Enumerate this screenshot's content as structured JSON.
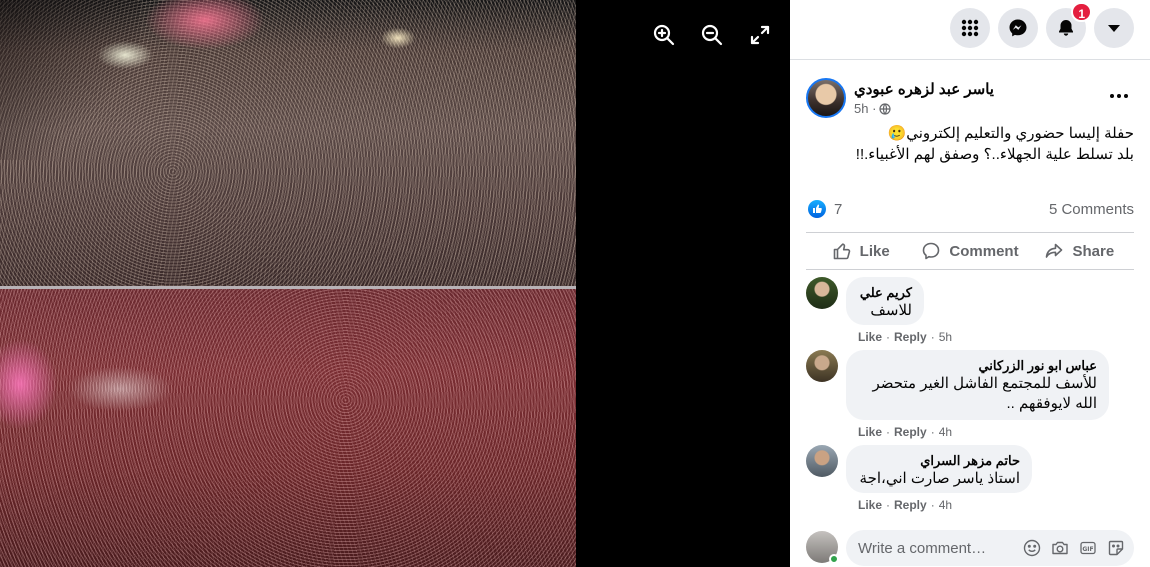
{
  "viewer": {
    "zoom_in_icon": "zoom-in-icon",
    "zoom_out_icon": "zoom-out-icon",
    "fullscreen_icon": "fullscreen-icon"
  },
  "topbar": {
    "menu_icon": "grid-menu-icon",
    "messenger_icon": "messenger-icon",
    "notifications_icon": "bell-icon",
    "notifications_count": "1",
    "account_icon": "caret-down-icon"
  },
  "post": {
    "author": "ياسر عبد لزهره عبودي",
    "time": "5h ·",
    "privacy_icon": "globe-icon",
    "text_line1": "حفلة إليسا حضوري والتعليم إلكتروني🥲",
    "text_line2": "بلد تسلط علية الجهلاء..؟ وصفق لهم الأغبياء.!!",
    "reaction_count": "7",
    "comments_count": "5 Comments",
    "like_label": "Like",
    "comment_label": "Comment",
    "share_label": "Share"
  },
  "comments": [
    {
      "name": "كريم علي",
      "text": "للاسف",
      "like": "Like",
      "reply": "Reply",
      "time": "5h"
    },
    {
      "name": "عباس ابو نور الزركاني",
      "text": "للأسف للمجتمع الفاشل الغير متحضر الله لايوفقهم ..",
      "like": "Like",
      "reply": "Reply",
      "time": "4h"
    },
    {
      "name": "حاتم مزهر السراي",
      "text": "استاذ ياسر صارت اني،اجة",
      "like": "Like",
      "reply": "Reply",
      "time": "4h"
    }
  ],
  "composer": {
    "placeholder": "Write a comment…",
    "icons": [
      "emoji-icon",
      "camera-icon",
      "gif-icon",
      "sticker-icon"
    ]
  },
  "colors": {
    "accent": "#1877f2",
    "notification": "#e41e3f",
    "online": "#31a24c"
  }
}
